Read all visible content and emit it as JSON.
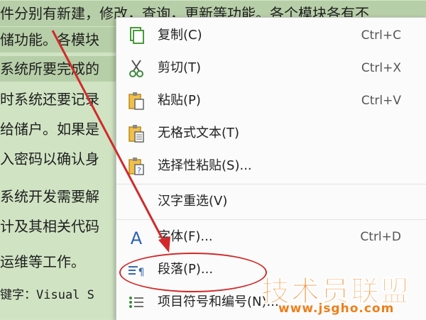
{
  "document": {
    "lines": [
      {
        "text": "件分别有新建，修改，查询，更新等功能。各个模块各有不"
      },
      {
        "text": "储功能。各模块"
      },
      {
        "text": "系统所要完成的"
      },
      {
        "text": "时系统还要记录"
      },
      {
        "text": "给储户。如果是"
      },
      {
        "text": "入密码以确认身"
      },
      {
        "text": "系统开发需要解"
      },
      {
        "text": "计及其相关代码"
      },
      {
        "text": "运维等工作。"
      },
      {
        "text": "键字：Visual S"
      }
    ]
  },
  "context_menu": {
    "items": [
      {
        "label": "复制(C)",
        "shortcut": "Ctrl+C",
        "icon": "copy-icon"
      },
      {
        "label": "剪切(T)",
        "shortcut": "Ctrl+X",
        "icon": "scissors-icon"
      },
      {
        "label": "粘贴(P)",
        "shortcut": "Ctrl+V",
        "icon": "paste-icon"
      },
      {
        "label": "无格式文本(T)",
        "shortcut": "",
        "icon": "paste-plain-text-icon"
      },
      {
        "label": "选择性粘贴(S)...",
        "shortcut": "",
        "icon": "paste-special-icon"
      },
      {
        "label": "汉字重选(V)",
        "shortcut": "",
        "icon": ""
      },
      {
        "label": "字体(F)...",
        "shortcut": "Ctrl+D",
        "icon": "font-icon"
      },
      {
        "label": "段落(P)...",
        "shortcut": "",
        "icon": "paragraph-icon"
      },
      {
        "label": "项目符号和编号(N)...",
        "shortcut": "",
        "icon": "bullet-list-icon"
      }
    ]
  },
  "watermark": {
    "title": "技术员联盟",
    "url": "www.jsgho.com"
  },
  "colors": {
    "document_bg": "#d0e4c3",
    "selection": "#b7cfa8",
    "menu_bg": "#fbfbfb",
    "annotation_red": "#d22a2a",
    "watermark_orange": "#ef7f1a"
  }
}
